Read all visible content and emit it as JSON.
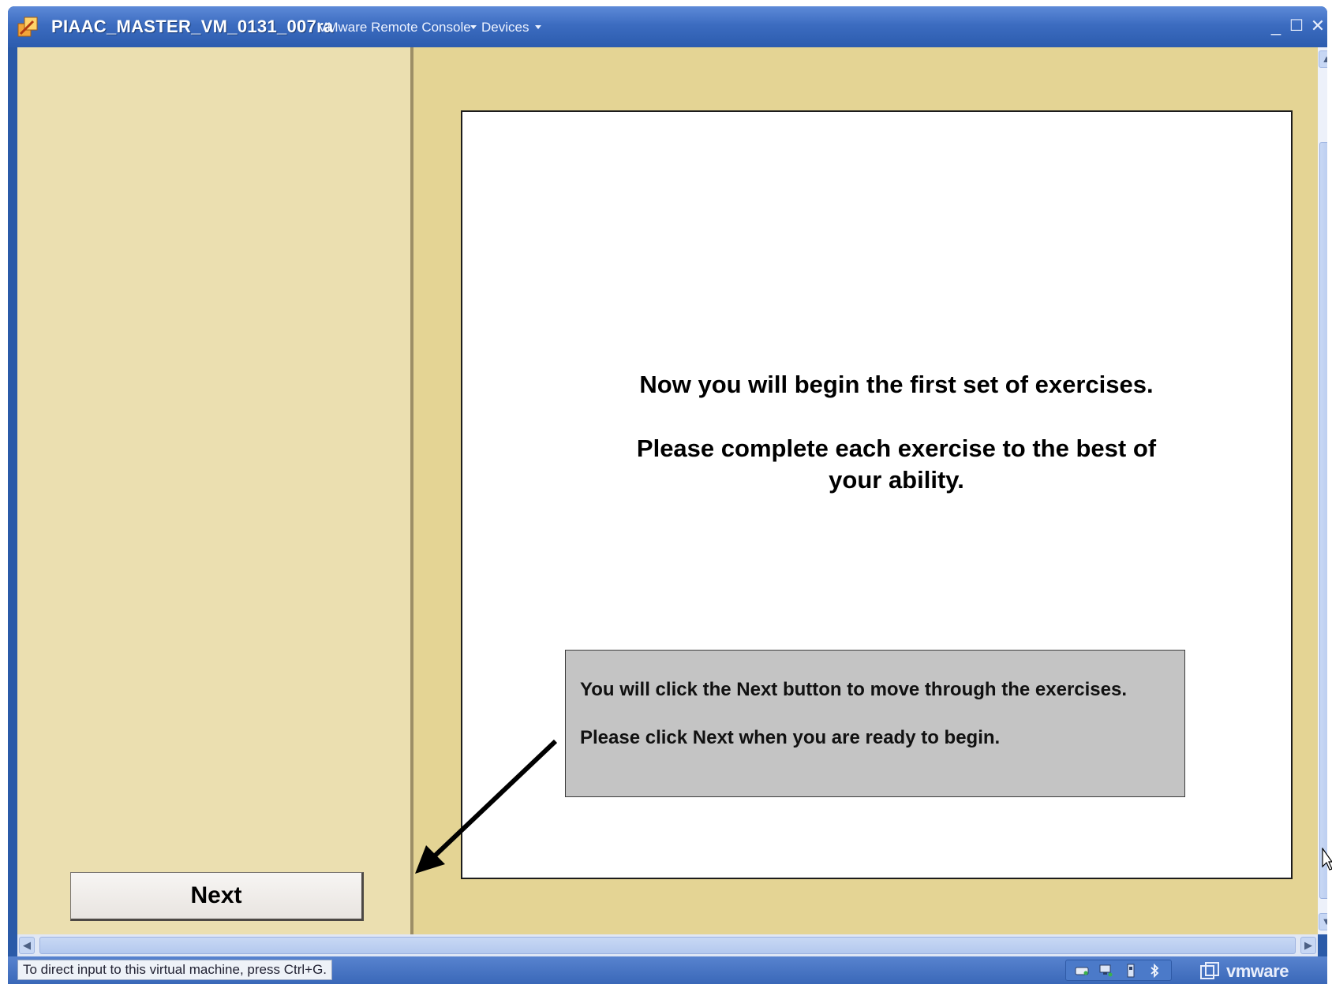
{
  "window": {
    "title": "PIAAC_MASTER_VM_0131_007ra",
    "menu_items": [
      {
        "label": "VMware Remote Console"
      },
      {
        "label": "Devices"
      }
    ],
    "controls": {
      "minimize": "_",
      "maximize": "☐",
      "close": "✕"
    }
  },
  "left_panel": {
    "next_button_label": "Next"
  },
  "content": {
    "heading_line1": "Now you will begin the first set of exercises.",
    "heading_line2": "Please complete each exercise to the best of your ability.",
    "info_box": {
      "line1": "You will click the Next button to move through the exercises.",
      "line2": "Please click Next when you are ready to begin."
    }
  },
  "statusbar": {
    "message": "To direct input to this virtual machine, press Ctrl+G.",
    "brand": "vmware",
    "tray_icons": [
      "hard-disk-icon",
      "network-icon",
      "usb-icon",
      "bluetooth-icon"
    ]
  },
  "colors": {
    "title_bar": "#3c6cc0",
    "desktop": "#e4d494",
    "left_panel": "#ebdfb0",
    "info_box": "#c4c4c4"
  }
}
